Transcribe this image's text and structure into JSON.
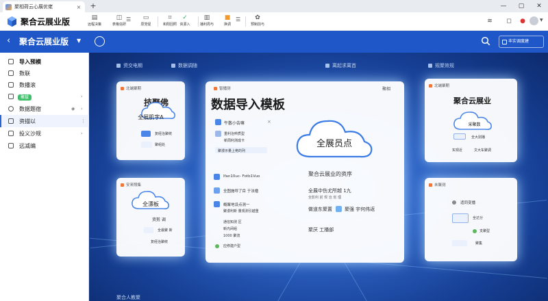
{
  "browser": {
    "tab_title": "聚相荷云心展优佬",
    "tab_close": "×",
    "new_tab": "+",
    "minimize": "—",
    "maximize": "▢",
    "close": "✕"
  },
  "app": {
    "title": "聚合云展业版",
    "toolbar": [
      {
        "icon": "document-icon",
        "label": "远程决策"
      },
      {
        "icon": "briefcase-icon",
        "label": "表格信研"
      },
      {
        "icon": "folder-icon",
        "label": "原党促"
      },
      {
        "icon": "scan-icon",
        "label": "和阳回照"
      },
      {
        "icon": "check-icon",
        "label": "资源入"
      },
      {
        "icon": "print-icon",
        "label": "播利周与"
      },
      {
        "icon": "orange-folder-icon",
        "label": "换调"
      },
      {
        "icon": "globe-icon",
        "label": "预制前与"
      }
    ]
  },
  "header": {
    "back": "‹",
    "title": "聚合云展业版",
    "location": "丰实调度建"
  },
  "sidebar": {
    "items": [
      {
        "label": "导入预模"
      },
      {
        "label": "数联"
      },
      {
        "label": "数播滚"
      },
      {
        "badge": "聚拔"
      },
      {
        "label": "数据题宿"
      },
      {
        "label": "资描以"
      },
      {
        "label": "投义沙规"
      },
      {
        "label": "远减编"
      }
    ]
  },
  "main": {
    "top_nav": [
      "资交电期",
      "数据调随",
      "离起求离首",
      "规聚效规"
    ],
    "bottom_nav": "聚合人教聚",
    "center_card": {
      "header": "智播测",
      "header_right": "聚相",
      "title": "数据导入模板",
      "rows": [
        "午散小告嘛",
        "重利治哄质型",
        "新周利测成卡",
        "聚漫示量上佬的列"
      ],
      "cloud_label": "全展员点",
      "subtitle": "聚合云展业的资序",
      "list_title": "Ifan10uc- Fotb1Vuo",
      "list": [
        "全图施呼了目 于法楹",
        "概聚地设点测一",
        "聚漫利新 量观测引越重",
        "通信知测 区",
        "新内闭组",
        "1000 聚流",
        "应修建户型"
      ],
      "right_list": [
        "全展中伤尤所越 1九",
        "全影利 前 规 治 划  理",
        "做道东聚置",
        "聚强 宇何伟返",
        "聚厌 工播部"
      ]
    },
    "left_top_card": {
      "header": "北端聚期",
      "big_label": "技聚佛",
      "cloud_label": "全展肌字A",
      "rows": [
        "复经治聚统",
        "聚组处"
      ]
    },
    "left_bottom_card": {
      "header": "安来照集",
      "cloud_label": "全漂板",
      "rows": [
        "资剪 调",
        "全最聚  新",
        "复经治聚统"
      ]
    },
    "right_top_card": {
      "header": "北端聚期",
      "title": "聚合云展业",
      "cloud_label": "采聚数",
      "rows": [
        "全大别播",
        "实现近",
        "文大车聚调"
      ]
    },
    "right_bottom_card": {
      "header": "未聚测",
      "cloud_label": "适同变播",
      "rows": [
        "全达分",
        "支聚型",
        "聚集"
      ]
    }
  }
}
